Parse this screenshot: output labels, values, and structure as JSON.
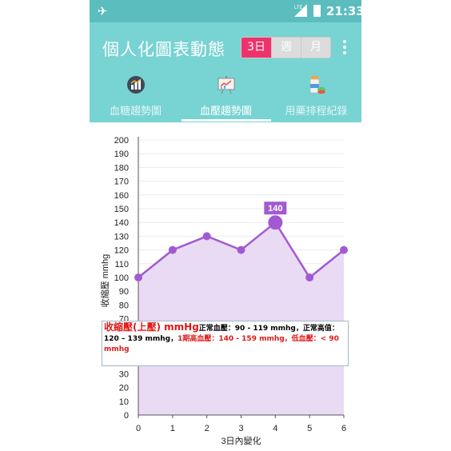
{
  "status_bar": {
    "time": "21:33",
    "network": "LTE"
  },
  "header": {
    "title": "個人化圖表動態",
    "range_options": [
      "3日",
      "週",
      "月"
    ],
    "selected_range": "3日"
  },
  "tabs": [
    {
      "label": "血糖趨勢圖",
      "icon": "bar-chart-icon",
      "active": false
    },
    {
      "label": "血壓趨勢圖",
      "icon": "presentation-chart-icon",
      "active": true
    },
    {
      "label": "用藥排程紀錄",
      "icon": "medicine-bottle-icon",
      "active": false
    }
  ],
  "colors": {
    "appbar": "#78d3d3",
    "statusbar": "#5bbdbe",
    "accent": "#f0326b",
    "series": "#a25ad3",
    "fill": "#e7d7f3",
    "alert": "#e01818"
  },
  "info": {
    "title": "收縮壓(上壓) mmHg",
    "normal": "正常血壓：90 - 119 mmhg，正常高值：120 – 139 mmhg，",
    "high": "1期高血壓：140 - 159 mmhg，低血壓：< 90 mmhg"
  },
  "chart_data": {
    "type": "area",
    "x": [
      0,
      1,
      2,
      3,
      4,
      5,
      6
    ],
    "series": [
      {
        "values": [
          100,
          120,
          130,
          120,
          140,
          100,
          120
        ]
      }
    ],
    "xlabel": "3日內變化",
    "ylabel": "收縮壓  mmhg",
    "ylim": [
      0,
      200
    ],
    "xlim": [
      0,
      6
    ],
    "ytick_step": 10,
    "highlight": {
      "x": 4,
      "label": "140"
    },
    "grid": true
  }
}
